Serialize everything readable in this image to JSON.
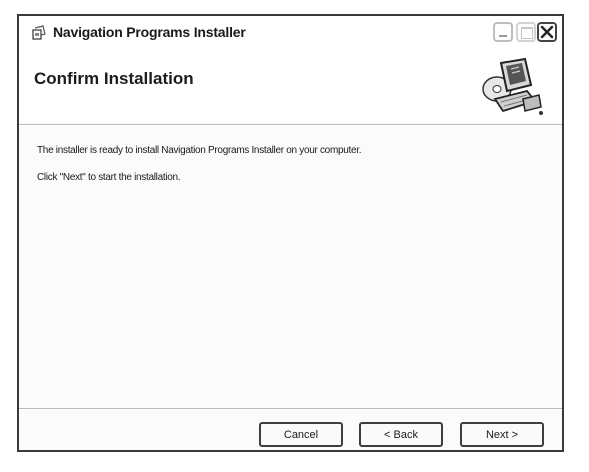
{
  "window": {
    "title": "Navigation Programs Installer"
  },
  "header": {
    "title": "Confirm Installation",
    "art_icon": "computer-install-icon"
  },
  "body": {
    "line1": "The installer is ready to install Navigation Programs Installer on your computer.",
    "line2": "Click \"Next\" to start the installation."
  },
  "buttons": {
    "cancel": "Cancel",
    "back": "< Back",
    "next": "Next >"
  },
  "colors": {
    "frame": "#3a3a3a",
    "background": "#fbfbfb",
    "text": "#1a1a1a"
  }
}
